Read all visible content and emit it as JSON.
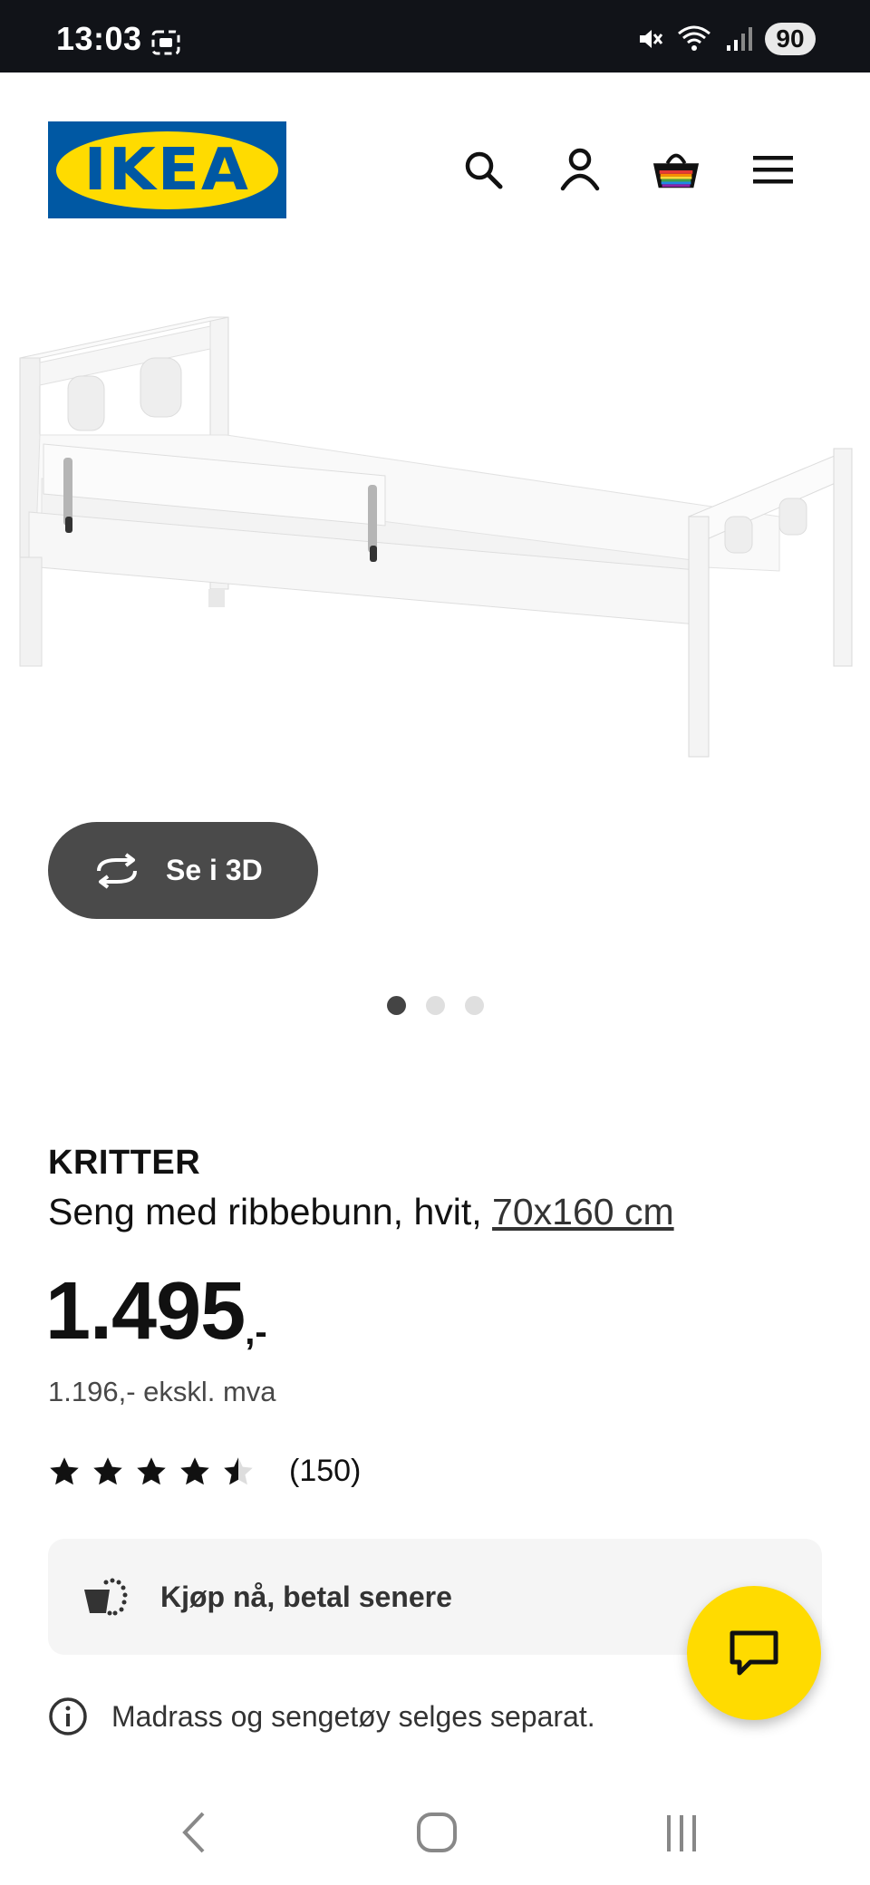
{
  "status_bar": {
    "time": "13:03",
    "battery": "90",
    "icons": [
      "screenshot-icon",
      "mute-icon",
      "wifi-icon",
      "signal-icon",
      "battery-icon"
    ]
  },
  "header": {
    "logo_text": "IKEA",
    "icons": [
      "search-icon",
      "account-icon",
      "cart-icon",
      "menu-icon"
    ],
    "brand_blue": "#0058a3",
    "brand_yellow": "#ffdb00"
  },
  "gallery": {
    "view_3d_label": "Se i 3D",
    "image_count": 3,
    "active_index": 0
  },
  "product": {
    "name": "KRITTER",
    "description": "Seng med ribbebunn, hvit, ",
    "size_link": "70x160 cm",
    "price": "1.495",
    "price_suffix": ",-",
    "price_ex_vat": "1.196,- ekskl. mva",
    "rating": 4.5,
    "review_count": "(150)"
  },
  "pay_later": {
    "label": "Kjøp nå, betal senere"
  },
  "notice": {
    "text": "Madrass og sengetøy selges separat."
  },
  "chat": {
    "icon": "chat-icon"
  },
  "nav": {
    "icons": [
      "back-icon",
      "home-icon",
      "recents-icon"
    ]
  }
}
